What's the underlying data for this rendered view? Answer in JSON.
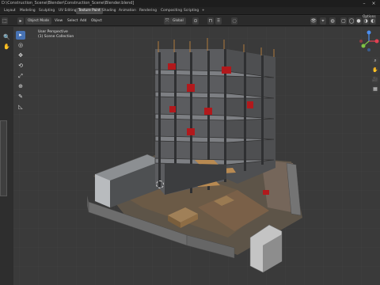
{
  "window": {
    "title": "D:\\Construction_Scene\\Blender\\Construction_Scene\\Blender.blend]",
    "minimize_icon": "minimize-icon",
    "close_icon": "close-icon"
  },
  "workspaces": [
    "Layout",
    "Modeling",
    "Sculpting",
    "UV Editing",
    "Texture Paint",
    "Shading",
    "Animation",
    "Rendering",
    "Compositing",
    "Scripting"
  ],
  "active_workspace": "Texture Paint",
  "workspace_add": "+",
  "header": {
    "mode": "Object Mode",
    "menus": [
      "View",
      "Select",
      "Add",
      "Object"
    ],
    "orientation": "Global",
    "options": "Options"
  },
  "viewport": {
    "perspective": "User Perspective",
    "collection": "(1) Scene Collection"
  },
  "tools": [
    {
      "name": "select-cursor-icon",
      "glyph": "▸",
      "active": true
    },
    {
      "name": "cursor-icon",
      "glyph": "◎",
      "active": false
    },
    {
      "name": "move-icon",
      "glyph": "✥",
      "active": false
    },
    {
      "name": "rotate-icon",
      "glyph": "⟲",
      "active": false
    },
    {
      "name": "scale-icon",
      "glyph": "⤢",
      "active": false
    },
    {
      "name": "transform-icon",
      "glyph": "⊕",
      "active": false
    },
    {
      "name": "annotate-icon",
      "glyph": "✎",
      "active": false
    },
    {
      "name": "measure-icon",
      "glyph": "◺",
      "active": false
    }
  ],
  "colors": {
    "accent": "#4772b3",
    "x_axis": "#e24152",
    "y_axis": "#7fc344",
    "z_axis": "#4b8ef0"
  }
}
